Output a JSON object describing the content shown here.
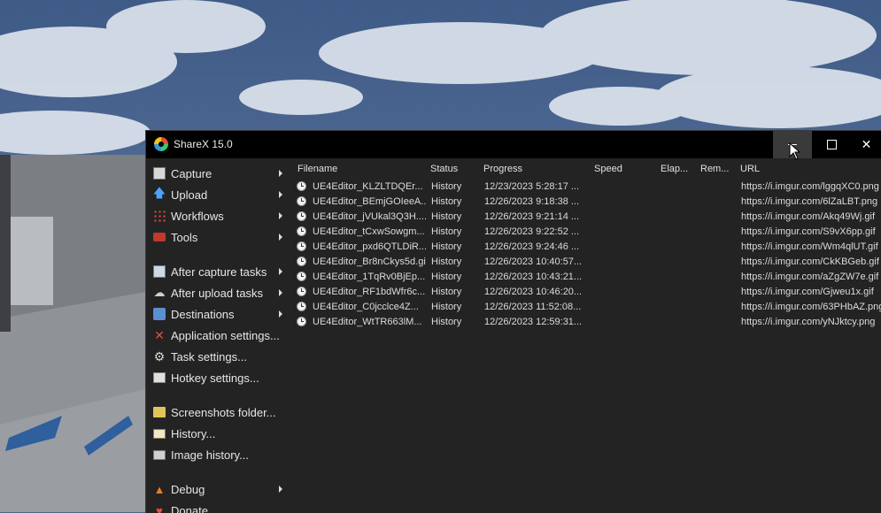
{
  "window": {
    "title": "ShareX 15.0"
  },
  "menu": [
    {
      "label": "Capture",
      "icon": "capture-icon",
      "submenu": true
    },
    {
      "label": "Upload",
      "icon": "upload-icon",
      "submenu": true
    },
    {
      "label": "Workflows",
      "icon": "workflows-icon",
      "submenu": true
    },
    {
      "label": "Tools",
      "icon": "tools-icon",
      "submenu": true
    },
    {
      "label": "After capture tasks",
      "icon": "after-capture-icon",
      "submenu": true
    },
    {
      "label": "After upload tasks",
      "icon": "after-upload-icon",
      "submenu": true
    },
    {
      "label": "Destinations",
      "icon": "destinations-icon",
      "submenu": true
    },
    {
      "label": "Application settings...",
      "icon": "application-settings-icon",
      "submenu": false
    },
    {
      "label": "Task settings...",
      "icon": "task-settings-icon",
      "submenu": false
    },
    {
      "label": "Hotkey settings...",
      "icon": "hotkey-settings-icon",
      "submenu": false
    },
    {
      "label": "Screenshots folder...",
      "icon": "folder-icon",
      "submenu": false
    },
    {
      "label": "History...",
      "icon": "history-icon",
      "submenu": false
    },
    {
      "label": "Image history...",
      "icon": "image-history-icon",
      "submenu": false
    },
    {
      "label": "Debug",
      "icon": "debug-icon",
      "submenu": true
    },
    {
      "label": "Donate...",
      "icon": "donate-icon",
      "submenu": false
    }
  ],
  "list": {
    "columns": [
      "Filename",
      "Status",
      "Progress",
      "Speed",
      "Elap...",
      "Rem...",
      "URL"
    ],
    "rows": [
      {
        "filename": "UE4Editor_KLZLTDQEr...",
        "status": "History",
        "progress": "12/23/2023 5:28:17 ...",
        "url": "https://i.imgur.com/lggqXC0.png"
      },
      {
        "filename": "UE4Editor_BEmjGOIeeA...",
        "status": "History",
        "progress": "12/26/2023 9:18:38 ...",
        "url": "https://i.imgur.com/6lZaLBT.png"
      },
      {
        "filename": "UE4Editor_jVUkal3Q3H....",
        "status": "History",
        "progress": "12/26/2023 9:21:14 ...",
        "url": "https://i.imgur.com/Akq49Wj.gif"
      },
      {
        "filename": "UE4Editor_tCxwSowgm...",
        "status": "History",
        "progress": "12/26/2023 9:22:52 ...",
        "url": "https://i.imgur.com/S9vX6pp.gif"
      },
      {
        "filename": "UE4Editor_pxd6QTLDiR...",
        "status": "History",
        "progress": "12/26/2023 9:24:46 ...",
        "url": "https://i.imgur.com/Wm4qlUT.gif"
      },
      {
        "filename": "UE4Editor_Br8nCkys5d.gif",
        "status": "History",
        "progress": "12/26/2023 10:40:57...",
        "url": "https://i.imgur.com/CkKBGeb.gif"
      },
      {
        "filename": "UE4Editor_1TqRv0BjEp...",
        "status": "History",
        "progress": "12/26/2023 10:43:21...",
        "url": "https://i.imgur.com/aZgZW7e.gif"
      },
      {
        "filename": "UE4Editor_RF1bdWfr6c...",
        "status": "History",
        "progress": "12/26/2023 10:46:20...",
        "url": "https://i.imgur.com/Gjweu1x.gif"
      },
      {
        "filename": "UE4Editor_C0jcclce4Z...",
        "status": "History",
        "progress": "12/26/2023 11:52:08...",
        "url": "https://i.imgur.com/63PHbAZ.png"
      },
      {
        "filename": "UE4Editor_WtTR663lM...",
        "status": "History",
        "progress": "12/26/2023 12:59:31...",
        "url": "https://i.imgur.com/yNJktcy.png"
      }
    ]
  }
}
